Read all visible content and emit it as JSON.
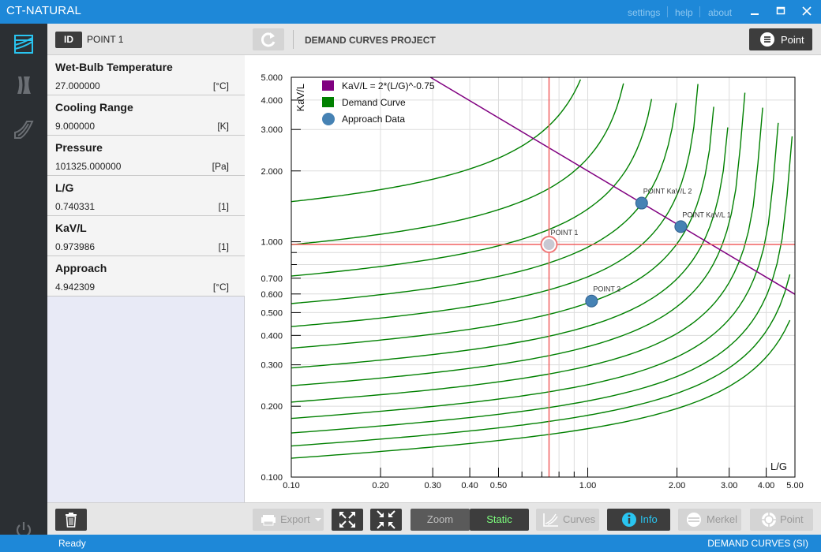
{
  "window": {
    "title": "CT-NATURAL",
    "menu": [
      "settings",
      "help",
      "about"
    ]
  },
  "rail": {
    "items": [
      "demand-curves-icon",
      "tower-icon",
      "curve-fill-icon"
    ],
    "footer": "power-icon"
  },
  "sidebar": {
    "id_label": "ID",
    "point_name": "POINT 1",
    "properties": [
      {
        "name": "Wet-Bulb Temperature",
        "value": "27.000000",
        "unit": "[°C]"
      },
      {
        "name": "Cooling Range",
        "value": "9.000000",
        "unit": "[K]"
      },
      {
        "name": "Pressure",
        "value": "101325.000000",
        "unit": "[Pa]"
      },
      {
        "name": "L/G",
        "value": "0.740331",
        "unit": "[1]"
      },
      {
        "name": "KaV/L",
        "value": "0.973986",
        "unit": "[1]"
      },
      {
        "name": "Approach",
        "value": "4.942309",
        "unit": "[°C]"
      }
    ]
  },
  "header": {
    "project_title": "DEMAND CURVES PROJECT",
    "point_button": "Point"
  },
  "toolbar": {
    "export": "Export",
    "zoom": "Zoom",
    "static": "Static",
    "curves": "Curves",
    "info": "Info",
    "merkel": "Merkel",
    "point": "Point"
  },
  "status": {
    "left": "Ready",
    "right": "DEMAND CURVES (SI)"
  },
  "colors": {
    "titlebar": "#1e88d8",
    "rail": "#2b2f33",
    "demand_curve": "#008000",
    "kavl_line": "#800080",
    "approach_point": "#4682b4",
    "crosshair": "#f06060",
    "static_active": "#7dff7d"
  },
  "chart_data": {
    "type": "line",
    "xscale": "log",
    "yscale": "log",
    "xlabel": "L/G",
    "ylabel": "KaV/L",
    "xlim": [
      0.1,
      5.0
    ],
    "ylim": [
      0.1,
      5.0
    ],
    "grid": true,
    "legend_position": "top-left",
    "x_ticks": [
      "0.10",
      "0.20",
      "0.30",
      "0.40",
      "0.50",
      "1.00",
      "2.00",
      "3.00",
      "4.00",
      "5.00"
    ],
    "x_tick_values": [
      0.1,
      0.2,
      0.3,
      0.4,
      0.5,
      1.0,
      2.0,
      3.0,
      4.0,
      5.0
    ],
    "y_ticks": [
      "0.100",
      "0.200",
      "0.300",
      "0.400",
      "0.500",
      "0.600",
      "0.700",
      "1.000",
      "2.000",
      "3.000",
      "4.000",
      "5.000"
    ],
    "y_tick_values": [
      0.1,
      0.2,
      0.3,
      0.4,
      0.5,
      0.6,
      0.7,
      1.0,
      2.0,
      3.0,
      4.0,
      5.0
    ],
    "legend": [
      {
        "label": "KaV/L = 2*(L/G)^-0.75",
        "marker": "square",
        "color": "#800080"
      },
      {
        "label": "Demand Curve",
        "marker": "square",
        "color": "#008000"
      },
      {
        "label": "Approach Data",
        "marker": "circle",
        "color": "#4682b4"
      }
    ],
    "kavl_line": {
      "coefficient": 2,
      "exponent": -0.75
    },
    "demand_curves_y_at_xmin": [
      1.4,
      0.93,
      0.69,
      0.53,
      0.425,
      0.345,
      0.285,
      0.24,
      0.205,
      0.175,
      0.152,
      0.134,
      0.119
    ],
    "points": [
      {
        "label": "POINT 1",
        "x": 0.740331,
        "y": 0.973986,
        "selected": true
      },
      {
        "label": "POINT 2",
        "x": 1.03,
        "y": 0.56,
        "selected": false
      },
      {
        "label": "POINT KaV/L 1",
        "x": 2.06,
        "y": 1.16,
        "selected": false
      },
      {
        "label": "POINT KaV/L 2",
        "x": 1.52,
        "y": 1.46,
        "selected": false
      }
    ],
    "crosshair": {
      "x": 0.740331,
      "y": 0.973986
    }
  }
}
